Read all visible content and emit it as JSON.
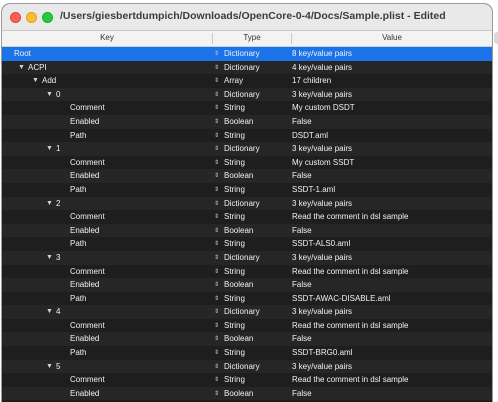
{
  "window": {
    "title": "/Users/giesbertdumpich/Downloads/OpenCore-0-4/Docs/Sample.plist - Edited"
  },
  "columns": {
    "key": "Key",
    "type": "Type",
    "value": "Value"
  },
  "rows": [
    {
      "key": "Root",
      "type": "Dictionary",
      "value": "8 key/value pairs",
      "level": 0,
      "disclosure": "",
      "selected": true
    },
    {
      "key": "ACPI",
      "type": "Dictionary",
      "value": "4 key/value pairs",
      "level": 1,
      "disclosure": "▼"
    },
    {
      "key": "Add",
      "type": "Array",
      "value": "17 children",
      "level": 2,
      "disclosure": "▼"
    },
    {
      "key": "0",
      "type": "Dictionary",
      "value": "3 key/value pairs",
      "level": 3,
      "disclosure": "▼"
    },
    {
      "key": "Comment",
      "type": "String",
      "value": "My custom DSDT",
      "level": 4,
      "disclosure": ""
    },
    {
      "key": "Enabled",
      "type": "Boolean",
      "value": "False",
      "level": 4,
      "disclosure": ""
    },
    {
      "key": "Path",
      "type": "String",
      "value": "DSDT.aml",
      "level": 4,
      "disclosure": ""
    },
    {
      "key": "1",
      "type": "Dictionary",
      "value": "3 key/value pairs",
      "level": 3,
      "disclosure": "▼"
    },
    {
      "key": "Comment",
      "type": "String",
      "value": "My custom SSDT",
      "level": 4,
      "disclosure": ""
    },
    {
      "key": "Enabled",
      "type": "Boolean",
      "value": "False",
      "level": 4,
      "disclosure": ""
    },
    {
      "key": "Path",
      "type": "String",
      "value": "SSDT-1.aml",
      "level": 4,
      "disclosure": ""
    },
    {
      "key": "2",
      "type": "Dictionary",
      "value": "3 key/value pairs",
      "level": 3,
      "disclosure": "▼"
    },
    {
      "key": "Comment",
      "type": "String",
      "value": "Read the comment in dsl sample",
      "level": 4,
      "disclosure": ""
    },
    {
      "key": "Enabled",
      "type": "Boolean",
      "value": "False",
      "level": 4,
      "disclosure": ""
    },
    {
      "key": "Path",
      "type": "String",
      "value": "SSDT-ALS0.aml",
      "level": 4,
      "disclosure": ""
    },
    {
      "key": "3",
      "type": "Dictionary",
      "value": "3 key/value pairs",
      "level": 3,
      "disclosure": "▼"
    },
    {
      "key": "Comment",
      "type": "String",
      "value": "Read the comment in dsl sample",
      "level": 4,
      "disclosure": ""
    },
    {
      "key": "Enabled",
      "type": "Boolean",
      "value": "False",
      "level": 4,
      "disclosure": ""
    },
    {
      "key": "Path",
      "type": "String",
      "value": "SSDT-AWAC-DISABLE.aml",
      "level": 4,
      "disclosure": ""
    },
    {
      "key": "4",
      "type": "Dictionary",
      "value": "3 key/value pairs",
      "level": 3,
      "disclosure": "▼"
    },
    {
      "key": "Comment",
      "type": "String",
      "value": "Read the comment in dsl sample",
      "level": 4,
      "disclosure": ""
    },
    {
      "key": "Enabled",
      "type": "Boolean",
      "value": "False",
      "level": 4,
      "disclosure": ""
    },
    {
      "key": "Path",
      "type": "String",
      "value": "SSDT-BRG0.aml",
      "level": 4,
      "disclosure": ""
    },
    {
      "key": "5",
      "type": "Dictionary",
      "value": "3 key/value pairs",
      "level": 3,
      "disclosure": "▼"
    },
    {
      "key": "Comment",
      "type": "String",
      "value": "Read the comment in dsl sample",
      "level": 4,
      "disclosure": ""
    },
    {
      "key": "Enabled",
      "type": "Boolean",
      "value": "False",
      "level": 4,
      "disclosure": ""
    }
  ],
  "colors": {
    "selection": "#1a73e8",
    "background": "#1e1e1e",
    "alt_row": "#262626"
  }
}
